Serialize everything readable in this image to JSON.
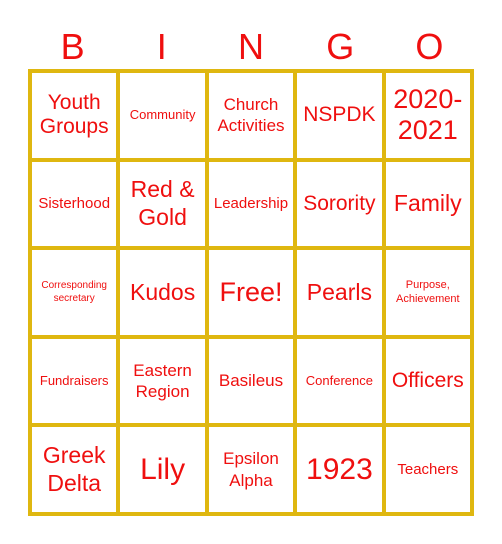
{
  "header": [
    "B",
    "I",
    "N",
    "G",
    "O"
  ],
  "colors": {
    "text": "#ef0f0f",
    "grid": "#dfb710",
    "cell": "#ffffff"
  },
  "cells": [
    [
      "Youth Groups",
      "Community",
      "Church Activities",
      "NSPDK",
      "2020-2021"
    ],
    [
      "Sisterhood",
      "Red & Gold",
      "Leadership",
      "Sorority",
      "Family"
    ],
    [
      "Corresponding secretary",
      "Kudos",
      "Free!",
      "Pearls",
      "Purpose, Achievement"
    ],
    [
      "Fundraisers",
      "Eastern Region",
      "Basileus",
      "Conference",
      "Officers"
    ],
    [
      "Greek Delta",
      "Lily",
      "Epsilon Alpha",
      "1923",
      "Teachers"
    ]
  ]
}
